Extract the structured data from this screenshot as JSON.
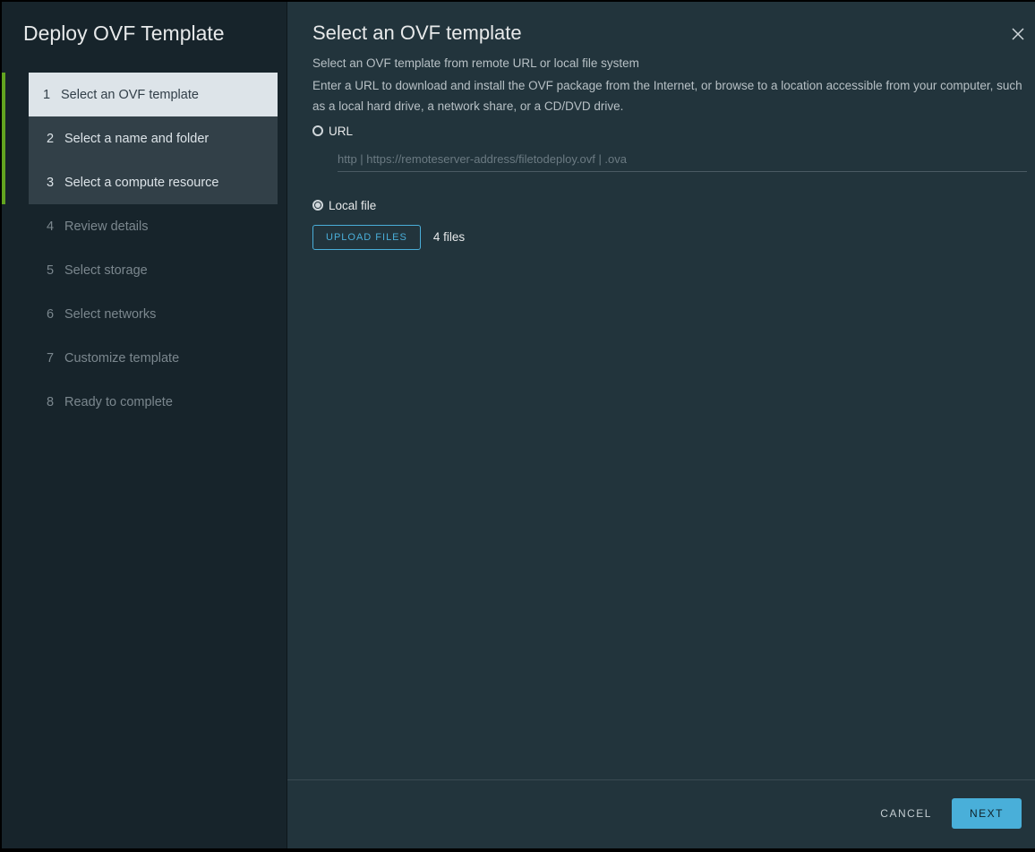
{
  "sidebar": {
    "title": "Deploy OVF Template",
    "steps": [
      {
        "num": "1",
        "label": "Select an OVF template",
        "state": "current"
      },
      {
        "num": "2",
        "label": "Select a name and folder",
        "state": "visited"
      },
      {
        "num": "3",
        "label": "Select a compute resource",
        "state": "visited"
      },
      {
        "num": "4",
        "label": "Review details",
        "state": "pending"
      },
      {
        "num": "5",
        "label": "Select storage",
        "state": "pending"
      },
      {
        "num": "6",
        "label": "Select networks",
        "state": "pending"
      },
      {
        "num": "7",
        "label": "Customize template",
        "state": "pending"
      },
      {
        "num": "8",
        "label": "Ready to complete",
        "state": "pending"
      }
    ]
  },
  "main": {
    "title": "Select an OVF template",
    "subtitle1": "Select an OVF template from remote URL or local file system",
    "subtitle2": "Enter a URL to download and install the OVF package from the Internet, or browse to a location accessible from your computer, such as a local hard drive, a network share, or a CD/DVD drive.",
    "options": {
      "url": {
        "label": "URL",
        "placeholder": "http | https://remoteserver-address/filetodeploy.ovf | .ova",
        "selected": false
      },
      "local": {
        "label": "Local file",
        "upload_label": "UPLOAD FILES",
        "file_count_text": "4 files",
        "selected": true
      }
    }
  },
  "footer": {
    "cancel_label": "CANCEL",
    "next_label": "NEXT"
  }
}
